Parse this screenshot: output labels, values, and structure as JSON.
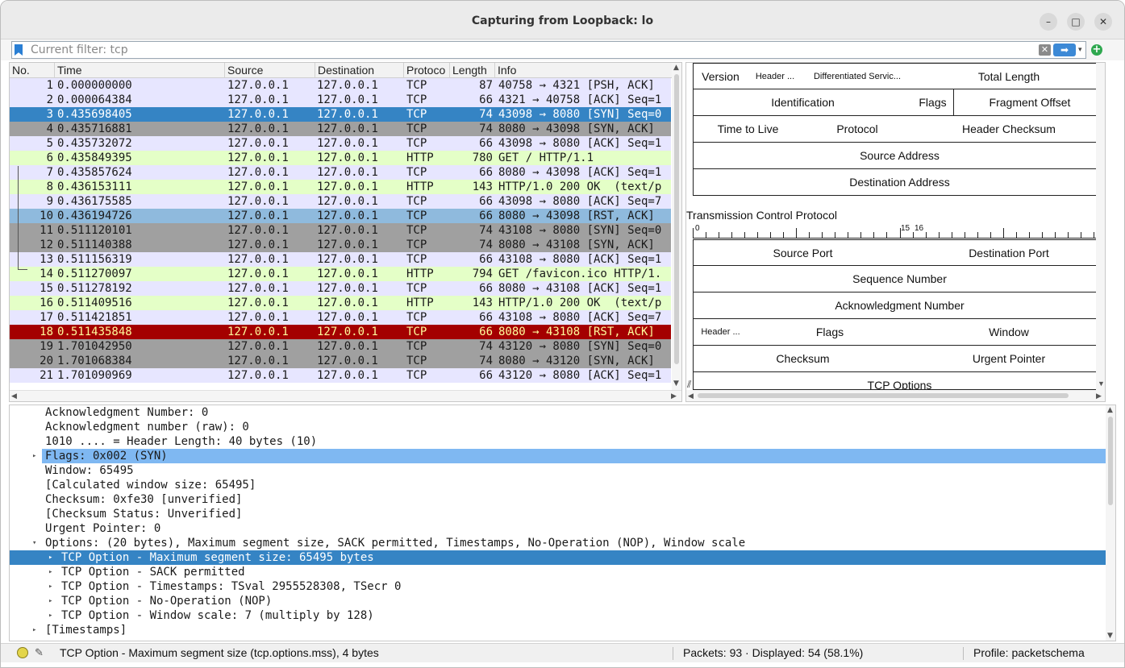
{
  "window": {
    "title": "Capturing from Loopback: lo",
    "min": "–",
    "max": "□",
    "close": "✕"
  },
  "filter": {
    "placeholder": "Current filter: tcp",
    "clear_glyph": "✕",
    "apply_glyph": "➡",
    "history_glyph": "▾",
    "add_glyph": "+"
  },
  "packet_list": {
    "columns": [
      "No.",
      "Time",
      "Source",
      "Destination",
      "Protoco",
      "Length",
      "Info"
    ],
    "rows": [
      {
        "no": "1",
        "time": "0.000000000",
        "src": "127.0.0.1",
        "dst": "127.0.0.1",
        "proto": "TCP",
        "len": "87",
        "info": "40758 → 4321 [PSH, ACK]",
        "style": "tcp"
      },
      {
        "no": "2",
        "time": "0.000064384",
        "src": "127.0.0.1",
        "dst": "127.0.0.1",
        "proto": "TCP",
        "len": "66",
        "info": "4321 → 40758 [ACK] Seq=1",
        "style": "tcp"
      },
      {
        "no": "3",
        "time": "0.435698405",
        "src": "127.0.0.1",
        "dst": "127.0.0.1",
        "proto": "TCP",
        "len": "74",
        "info": "43098 → 8080 [SYN] Seq=0",
        "style": "sel"
      },
      {
        "no": "4",
        "time": "0.435716881",
        "src": "127.0.0.1",
        "dst": "127.0.0.1",
        "proto": "TCP",
        "len": "74",
        "info": "8080 → 43098 [SYN, ACK]",
        "style": "syn"
      },
      {
        "no": "5",
        "time": "0.435732072",
        "src": "127.0.0.1",
        "dst": "127.0.0.1",
        "proto": "TCP",
        "len": "66",
        "info": "43098 → 8080 [ACK] Seq=1",
        "style": "tcp"
      },
      {
        "no": "6",
        "time": "0.435849395",
        "src": "127.0.0.1",
        "dst": "127.0.0.1",
        "proto": "HTTP",
        "len": "780",
        "info": "GET / HTTP/1.1",
        "style": "http"
      },
      {
        "no": "7",
        "time": "0.435857624",
        "src": "127.0.0.1",
        "dst": "127.0.0.1",
        "proto": "TCP",
        "len": "66",
        "info": "8080 → 43098 [ACK] Seq=1",
        "style": "tcp"
      },
      {
        "no": "8",
        "time": "0.436153111",
        "src": "127.0.0.1",
        "dst": "127.0.0.1",
        "proto": "HTTP",
        "len": "143",
        "info": "HTTP/1.0 200 OK  (text/p",
        "style": "http"
      },
      {
        "no": "9",
        "time": "0.436175585",
        "src": "127.0.0.1",
        "dst": "127.0.0.1",
        "proto": "TCP",
        "len": "66",
        "info": "43098 → 8080 [ACK] Seq=7",
        "style": "tcp"
      },
      {
        "no": "10",
        "time": "0.436194726",
        "src": "127.0.0.1",
        "dst": "127.0.0.1",
        "proto": "TCP",
        "len": "66",
        "info": "8080 → 43098 [RST, ACK]",
        "style": "relsel"
      },
      {
        "no": "11",
        "time": "0.511120101",
        "src": "127.0.0.1",
        "dst": "127.0.0.1",
        "proto": "TCP",
        "len": "74",
        "info": "43108 → 8080 [SYN] Seq=0",
        "style": "syn"
      },
      {
        "no": "12",
        "time": "0.511140388",
        "src": "127.0.0.1",
        "dst": "127.0.0.1",
        "proto": "TCP",
        "len": "74",
        "info": "8080 → 43108 [SYN, ACK]",
        "style": "syn"
      },
      {
        "no": "13",
        "time": "0.511156319",
        "src": "127.0.0.1",
        "dst": "127.0.0.1",
        "proto": "TCP",
        "len": "66",
        "info": "43108 → 8080 [ACK] Seq=1",
        "style": "tcp"
      },
      {
        "no": "14",
        "time": "0.511270097",
        "src": "127.0.0.1",
        "dst": "127.0.0.1",
        "proto": "HTTP",
        "len": "794",
        "info": "GET /favicon.ico HTTP/1.",
        "style": "http"
      },
      {
        "no": "15",
        "time": "0.511278192",
        "src": "127.0.0.1",
        "dst": "127.0.0.1",
        "proto": "TCP",
        "len": "66",
        "info": "8080 → 43108 [ACK] Seq=1",
        "style": "tcp"
      },
      {
        "no": "16",
        "time": "0.511409516",
        "src": "127.0.0.1",
        "dst": "127.0.0.1",
        "proto": "HTTP",
        "len": "143",
        "info": "HTTP/1.0 200 OK  (text/p",
        "style": "http"
      },
      {
        "no": "17",
        "time": "0.511421851",
        "src": "127.0.0.1",
        "dst": "127.0.0.1",
        "proto": "TCP",
        "len": "66",
        "info": "43108 → 8080 [ACK] Seq=7",
        "style": "tcp"
      },
      {
        "no": "18",
        "time": "0.511435848",
        "src": "127.0.0.1",
        "dst": "127.0.0.1",
        "proto": "TCP",
        "len": "66",
        "info": "8080 → 43108 [RST, ACK]",
        "style": "rst"
      },
      {
        "no": "19",
        "time": "1.701042950",
        "src": "127.0.0.1",
        "dst": "127.0.0.1",
        "proto": "TCP",
        "len": "74",
        "info": "43120 → 8080 [SYN] Seq=0",
        "style": "syn"
      },
      {
        "no": "20",
        "time": "1.701068384",
        "src": "127.0.0.1",
        "dst": "127.0.0.1",
        "proto": "TCP",
        "len": "74",
        "info": "8080 → 43120 [SYN, ACK]",
        "style": "syn"
      },
      {
        "no": "21",
        "time": "1.701090969",
        "src": "127.0.0.1",
        "dst": "127.0.0.1",
        "proto": "TCP",
        "len": "66",
        "info": "43120 → 8080 [ACK] Seq=1",
        "style": "tcp"
      }
    ]
  },
  "packet_diagram": {
    "ip_fields": {
      "version": "Version",
      "header_len": "Header ...",
      "dscp": "Differentiated Servic...",
      "total_length": "Total Length",
      "identification": "Identification",
      "flags": "Flags",
      "fragment_offset": "Fragment Offset",
      "ttl": "Time to Live",
      "protocol": "Protocol",
      "header_checksum": "Header Checksum",
      "source_address": "Source Address",
      "destination_address": "Destination Address"
    },
    "tcp_title": "Transmission Control Protocol",
    "ruler": {
      "start": "0",
      "mid_a": "15",
      "mid_b": "16"
    },
    "tcp_fields": {
      "source_port": "Source Port",
      "destination_port": "Destination Port",
      "sequence_number": "Sequence Number",
      "ack_number": "Acknowledgment Number",
      "header_len": "Header ...",
      "flags": "Flags",
      "window": "Window",
      "checksum": "Checksum",
      "urgent_pointer": "Urgent Pointer",
      "options": "TCP Options"
    }
  },
  "details": {
    "lines": [
      {
        "text": "Acknowledgment Number: 0",
        "indent": 1,
        "expander": "",
        "state": ""
      },
      {
        "text": "Acknowledgment number (raw): 0",
        "indent": 1,
        "expander": "",
        "state": ""
      },
      {
        "text": "1010 .... = Header Length: 40 bytes (10)",
        "indent": 1,
        "expander": "",
        "state": ""
      },
      {
        "text": "Flags: 0x002 (SYN)",
        "indent": 1,
        "expander": "▸",
        "state": "hl"
      },
      {
        "text": "Window: 65495",
        "indent": 1,
        "expander": "",
        "state": ""
      },
      {
        "text": "[Calculated window size: 65495]",
        "indent": 1,
        "expander": "",
        "state": ""
      },
      {
        "text": "Checksum: 0xfe30 [unverified]",
        "indent": 1,
        "expander": "",
        "state": ""
      },
      {
        "text": "[Checksum Status: Unverified]",
        "indent": 1,
        "expander": "",
        "state": ""
      },
      {
        "text": "Urgent Pointer: 0",
        "indent": 1,
        "expander": "",
        "state": ""
      },
      {
        "text": "Options: (20 bytes), Maximum segment size, SACK permitted, Timestamps, No-Operation (NOP), Window scale",
        "indent": 1,
        "expander": "▾",
        "state": ""
      },
      {
        "text": "TCP Option - Maximum segment size: 65495 bytes",
        "indent": 2,
        "expander": "▸",
        "state": "sel"
      },
      {
        "text": "TCP Option - SACK permitted",
        "indent": 2,
        "expander": "▸",
        "state": ""
      },
      {
        "text": "TCP Option - Timestamps: TSval 2955528308, TSecr 0",
        "indent": 2,
        "expander": "▸",
        "state": ""
      },
      {
        "text": "TCP Option - No-Operation (NOP)",
        "indent": 2,
        "expander": "▸",
        "state": ""
      },
      {
        "text": "TCP Option - Window scale: 7 (multiply by 128)",
        "indent": 2,
        "expander": "▸",
        "state": ""
      },
      {
        "text": "[Timestamps]",
        "indent": 1,
        "expander": "▸",
        "state": ""
      }
    ]
  },
  "status": {
    "message": "TCP Option - Maximum segment size (tcp.options.mss), 4 bytes",
    "packets": "Packets: 93 · Displayed: 54 (58.1%)",
    "profile": "Profile: packetschema"
  },
  "colors": {
    "tcp_row": "#e7e6ff",
    "http_row": "#e4ffc7",
    "syn_row": "#a0a0a0",
    "rst_row": "#a40000",
    "selected": "#3584c4",
    "highlight": "#7fb8f2"
  }
}
